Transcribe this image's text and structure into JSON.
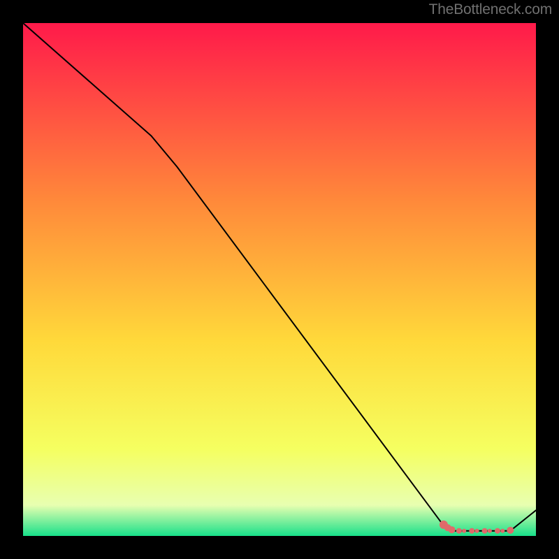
{
  "watermark": "TheBottleneck.com",
  "colors": {
    "gradient_top": "#ff1a4a",
    "gradient_upper_mid": "#ff8a3a",
    "gradient_mid": "#ffd93a",
    "gradient_lower_mid": "#f5ff60",
    "gradient_low": "#e8ffb0",
    "gradient_bottom": "#18e08a",
    "curve": "#000000",
    "marker_fill": "#e06a6a",
    "marker_stroke": "#b04848"
  },
  "chart_data": {
    "type": "line",
    "title": "",
    "xlabel": "",
    "ylabel": "",
    "xlim": [
      0,
      100
    ],
    "ylim": [
      0,
      100
    ],
    "curve": [
      {
        "x": 0,
        "y": 100
      },
      {
        "x": 25,
        "y": 78
      },
      {
        "x": 30,
        "y": 72
      },
      {
        "x": 82,
        "y": 2
      },
      {
        "x": 84,
        "y": 1
      },
      {
        "x": 95,
        "y": 1
      },
      {
        "x": 100,
        "y": 5
      }
    ],
    "markers_along_bottom": [
      {
        "x": 82.0,
        "y": 2.2,
        "r": 6
      },
      {
        "x": 82.8,
        "y": 1.6,
        "r": 5
      },
      {
        "x": 83.6,
        "y": 1.2,
        "r": 5
      },
      {
        "x": 85.0,
        "y": 1.0,
        "r": 4
      },
      {
        "x": 86.0,
        "y": 1.0,
        "r": 3
      },
      {
        "x": 87.5,
        "y": 1.0,
        "r": 4
      },
      {
        "x": 88.5,
        "y": 1.0,
        "r": 3
      },
      {
        "x": 90.0,
        "y": 1.0,
        "r": 4
      },
      {
        "x": 91.0,
        "y": 1.0,
        "r": 3
      },
      {
        "x": 92.5,
        "y": 1.0,
        "r": 4
      },
      {
        "x": 93.5,
        "y": 1.0,
        "r": 3
      },
      {
        "x": 95.0,
        "y": 1.1,
        "r": 5
      }
    ]
  }
}
